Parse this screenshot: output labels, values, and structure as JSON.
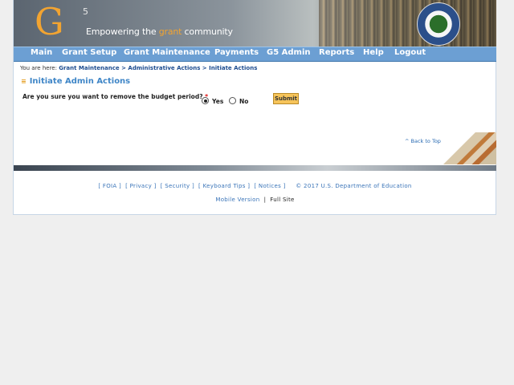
{
  "header": {
    "logo_letter": "G",
    "logo_superscript": "5",
    "tagline_before": "Empowering the ",
    "tagline_highlight": "grant",
    "tagline_after": " community"
  },
  "nav": {
    "items": [
      "Main",
      "Grant Setup",
      "Grant Maintenance",
      "Payments",
      "G5 Admin",
      "Reports",
      "Help",
      "Logout"
    ]
  },
  "breadcrumb": {
    "prefix": "You are here: ",
    "items": [
      "Grant Maintenance",
      "Administrative Actions",
      "Initiate Actions"
    ],
    "separator": " > "
  },
  "page": {
    "title": "Initiate Admin Actions",
    "question": "Are you sure you want to remove the budget period?",
    "required_mark": "*",
    "option_yes": "Yes",
    "option_no": "No",
    "selected": "Yes",
    "submit_label": "Submit",
    "back_to_top": "^ Back to Top"
  },
  "footer": {
    "links": [
      "FOIA",
      "Privacy",
      "Security",
      "Keyboard Tips",
      "Notices"
    ],
    "copyright": "© 2017 U.S. Department of Education",
    "mobile_version": "Mobile Version",
    "separator": "|",
    "full_site": "Full Site"
  },
  "colors": {
    "nav_bg": "#6c9fd3",
    "accent_orange": "#f2a431",
    "heading_blue": "#3f86c7",
    "link_blue": "#1d4c8f",
    "submit_bg": "#f6c45a"
  },
  "icons": {
    "seal": "department-of-education-seal",
    "heading_bullet": "list-bullet-icon"
  }
}
